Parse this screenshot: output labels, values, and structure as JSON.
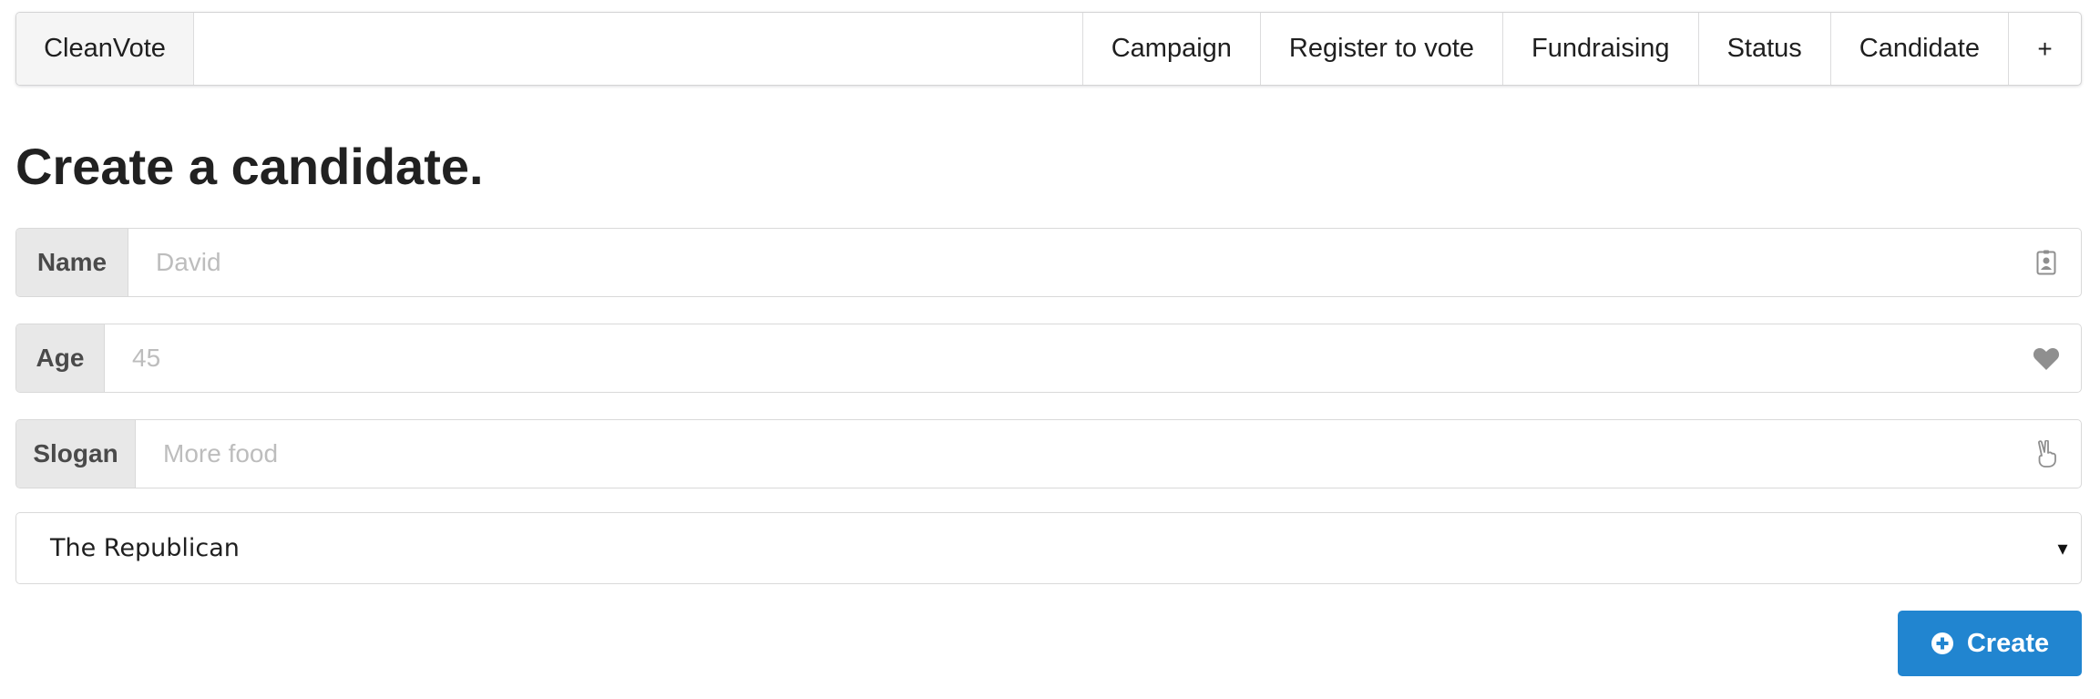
{
  "menu": {
    "brand": "CleanVote",
    "items": [
      {
        "label": "Campaign"
      },
      {
        "label": "Register to vote"
      },
      {
        "label": "Fundraising"
      },
      {
        "label": "Status"
      },
      {
        "label": "Candidate"
      },
      {
        "label": "+"
      }
    ]
  },
  "page": {
    "title": "Create a candidate."
  },
  "form": {
    "name": {
      "label": "Name",
      "placeholder": "David",
      "icon": "id-badge-icon"
    },
    "age": {
      "label": "Age",
      "placeholder": "45",
      "icon": "heart-icon"
    },
    "slogan": {
      "label": "Slogan",
      "placeholder": "More food",
      "icon": "hand-peace-icon"
    },
    "party": {
      "selected": "The Republican"
    },
    "submit": {
      "label": "Create",
      "icon": "plus-circle-icon"
    }
  },
  "colors": {
    "primary_button": "#2185d0",
    "label_background": "#e8e8e8",
    "brand_background": "#f5f5f5"
  }
}
